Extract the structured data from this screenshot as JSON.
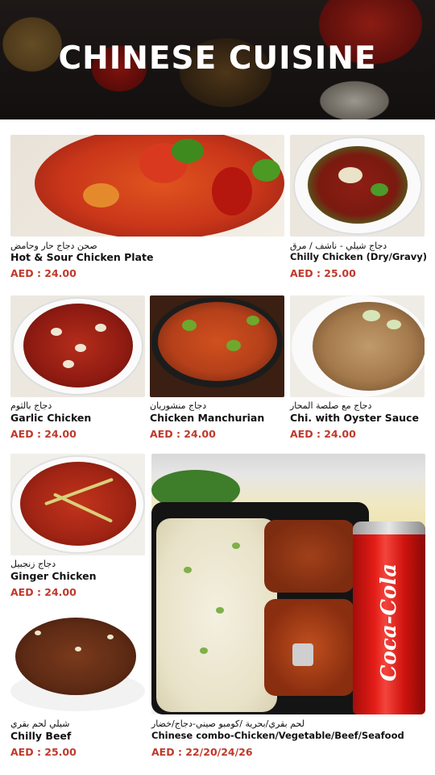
{
  "header": {
    "title": "CHINESE CUISINE"
  },
  "items": [
    {
      "ar": "صحن دجاج حار وحامض",
      "en": "Hot & Sour Chicken Plate",
      "price": "AED : 24.00"
    },
    {
      "ar": "دجاج شيلي - ناشف / مرق",
      "en": "Chilly Chicken (Dry/Gravy)",
      "price": "AED : 25.00"
    },
    {
      "ar": "دجاج بالثوم",
      "en": "Garlic Chicken",
      "price": "AED : 24.00"
    },
    {
      "ar": "دجاج منشوريان",
      "en": "Chicken Manchurian",
      "price": "AED : 24.00"
    },
    {
      "ar": "دجاج مع صلصة المحار",
      "en": "Chi. with Oyster Sauce",
      "price": "AED : 24.00"
    },
    {
      "ar": "دجاج زنجبيل",
      "en": "Ginger Chicken",
      "price": "AED : 24.00"
    },
    {
      "ar": "شيلي لحم بقري",
      "en": "Chilly Beef",
      "price": "AED : 25.00"
    },
    {
      "ar": "لحم بقري/بحرية /كومبو صيني-دجاج/خضار",
      "en": "Chinese combo-Chicken/Vegetable/Beef/Seafood",
      "price": "AED : 22/20/24/26"
    }
  ],
  "combo": {
    "can_brand": "Coca-Cola"
  },
  "colors": {
    "price": "#c0392b",
    "header_text": "#ffffff"
  }
}
